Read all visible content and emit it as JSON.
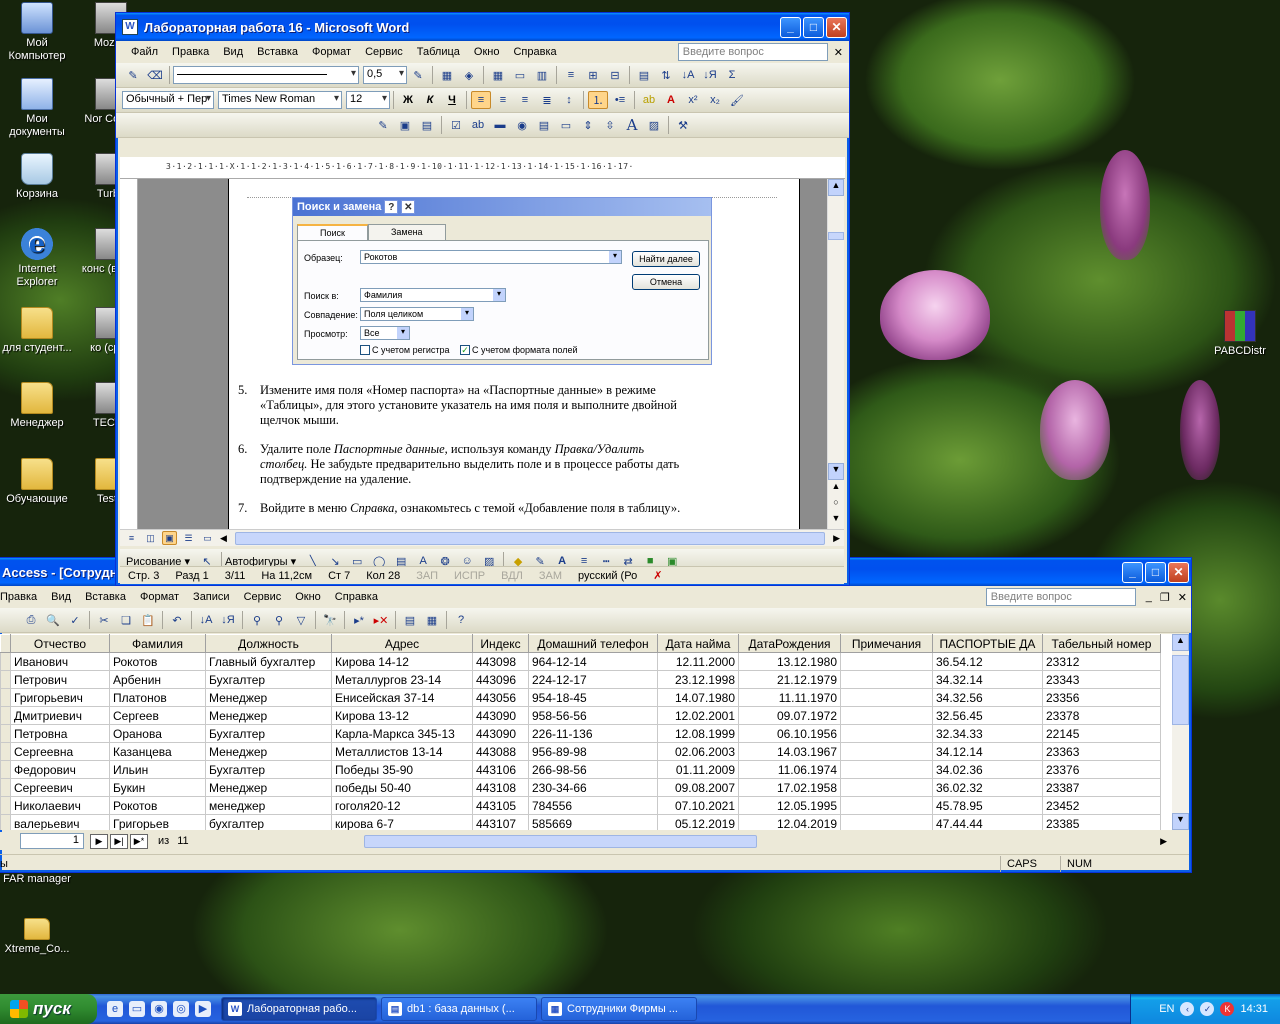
{
  "desktop": {
    "icons_left": [
      {
        "label": "Мой Компьютер",
        "icon": "computer-icon"
      },
      {
        "label": "Мои документы",
        "icon": "my-documents-icon"
      },
      {
        "label": "Корзина",
        "icon": "recycle-bin-icon"
      },
      {
        "label": "Internet Explorer",
        "icon": "internet-explorer-icon"
      },
      {
        "label": "для студент...",
        "icon": "folder-icon"
      },
      {
        "label": "Менеджер",
        "icon": "folder-icon"
      },
      {
        "label": "Обучающие",
        "icon": "folder-icon"
      }
    ],
    "icons_col2": [
      {
        "label": "Mozilla",
        "icon": "firefox-icon"
      },
      {
        "label": "Nor Comm",
        "icon": "app-icon"
      },
      {
        "label": "Turbo",
        "icon": "app-icon"
      },
      {
        "label": "конс (в шко",
        "icon": "app-icon"
      },
      {
        "label": "ко (сред",
        "icon": "app-icon"
      },
      {
        "label": "ТЕСТИ",
        "icon": "app-icon"
      },
      {
        "label": "TestC",
        "icon": "folder-icon"
      }
    ],
    "icons_bottom": [
      {
        "label": "FAR manager",
        "icon": "far-icon"
      },
      {
        "label": "Xtreme_Co...",
        "icon": "folder-icon"
      }
    ],
    "icon_right": {
      "label": "PABCDistr",
      "icon": "winrar-icon"
    }
  },
  "word": {
    "title": "Лабораторная работа 16 - Microsoft Word",
    "menu": [
      "Файл",
      "Правка",
      "Вид",
      "Вставка",
      "Формат",
      "Сервис",
      "Таблица",
      "Окно",
      "Справка"
    ],
    "ask_placeholder": "Введите вопрос",
    "line_width": "0,5",
    "style": "Обычный + Пер",
    "font": "Times New Roman",
    "size": "12",
    "ruler_text": "3·1·2·1·1·1·X·1·1·2·1·3·1·4·1·5·1·6·1·7·1·8·1·9·1·10·1·11·1·12·1·13·1·14·1·15·1·16·1·17·",
    "dialog": {
      "title": "Поиск и замена",
      "tab_find": "Поиск",
      "tab_replace": "Замена",
      "find_label": "Образец:",
      "find_value": "Рокотов",
      "find_next": "Найти далее",
      "cancel": "Отмена",
      "look_in_label": "Поиск в:",
      "look_in_value": "Фамилия",
      "match_label": "Совпадение:",
      "match_value": "Поля целиком",
      "search_label": "Просмотр:",
      "search_value": "Все",
      "match_case": "С учетом регистра",
      "match_format": "С учетом формата полей"
    },
    "items": [
      {
        "num": "5.",
        "line1": "Измените имя поля «Номер паспорта» на «Паспортные данные» в режиме",
        "line2": "«Таблицы», для этого установите указатель на имя поля и выполните двойной",
        "line3": "щелчок мыши."
      },
      {
        "num": "6.",
        "pre": "Удалите поле ",
        "em1": "Паспортные данные,",
        "mid": " используя команду ",
        "em2": "Правка/Удалить",
        "line2_em": "столбец.",
        "line2_rest": " Не забудьте предварительно выделить поле и в процессе работы дать",
        "line3": "подтверждение на удаление."
      },
      {
        "num": "7.",
        "pre": "Войдите в меню ",
        "em1": "Справка,",
        "post": " ознакомьтесь с темой «Добавление поля в таблицу»."
      }
    ],
    "drawing_label": "Рисование ▾",
    "autoshapes_label": "Автофигуры ▾",
    "status": {
      "page": "Стр.  3",
      "section": "Разд  1",
      "pages": "3/11",
      "at": "На 11,2см",
      "line": "Ст  7",
      "col": "Кол  28",
      "rec": "ЗАП",
      "trk": "ИСПР",
      "ext": "ВДЛ",
      "ovr": "ЗАМ",
      "lang": "русский (Ро"
    }
  },
  "access": {
    "title": "Access - [Сотрудн",
    "menu": [
      "Правка",
      "Вид",
      "Вставка",
      "Формат",
      "Записи",
      "Сервис",
      "Окно",
      "Справка"
    ],
    "ask_placeholder": "Введите вопрос",
    "columns": [
      "Отчество",
      "Фамилия",
      "Должность",
      "Адрес",
      "Индекс",
      "Домашний телефон",
      "Дата найма",
      "ДатаРождения",
      "Примечания",
      "ПАСПОРТЫЕ ДА",
      "Табельный номер"
    ],
    "rows": [
      [
        "Иванович",
        "Рокотов",
        "Главный бухгалтер",
        "Кирова 14-12",
        "443098",
        "964-12-14",
        "12.11.2000",
        "13.12.1980",
        "",
        "36.54.12",
        "23312"
      ],
      [
        "Петрович",
        "Арбенин",
        "Бухгалтер",
        "Металлургов 23-14",
        "443096",
        "224-12-17",
        "23.12.1998",
        "21.12.1979",
        "",
        "34.32.14",
        "23343"
      ],
      [
        "Григорьевич",
        "Платонов",
        "Менеджер",
        "Енисейская 37-14",
        "443056",
        "954-18-45",
        "14.07.1980",
        "11.11.1970",
        "",
        "34.32.56",
        "23356"
      ],
      [
        "Дмитриевич",
        "Сергеев",
        "Менеджер",
        "Кирова 13-12",
        "443090",
        "958-56-56",
        "12.02.2001",
        "09.07.1972",
        "",
        "32.56.45",
        "23378"
      ],
      [
        "Петровна",
        "Оранова",
        "Бухгалтер",
        "Карла-Маркса 345-13",
        "443090",
        "226-11-136",
        "12.08.1999",
        "06.10.1956",
        "",
        "32.34.33",
        "22145"
      ],
      [
        "Сергеевна",
        "Казанцева",
        "Менеджер",
        "Металлистов 13-14",
        "443088",
        "956-89-98",
        "02.06.2003",
        "14.03.1967",
        "",
        "34.12.14",
        "23363"
      ],
      [
        "Федорович",
        "Ильин",
        "Бухгалтер",
        "Победы 35-90",
        "443106",
        "266-98-56",
        "01.11.2009",
        "11.06.1974",
        "",
        "34.02.36",
        "23376"
      ],
      [
        "Сергеевич",
        "Букин",
        "Менеджер",
        "победы 50-40",
        "443108",
        "230-34-66",
        "09.08.2007",
        "17.02.1958",
        "",
        "36.02.32",
        "23387"
      ],
      [
        "Николаевич",
        "Рокотов",
        "менеджер",
        "гоголя20-12",
        "443105",
        "784556",
        "07.10.2021",
        "12.05.1995",
        "",
        "45.78.95",
        "23452"
      ],
      [
        "валерьевич",
        "Григорьев",
        "бухгалтер",
        "кирова 6-7",
        "443107",
        "585669",
        "05.12.2019",
        "12.04.2019",
        "",
        "47.44.44",
        "23385"
      ]
    ],
    "nav": {
      "record": "1",
      "of_label": "из",
      "total": "11"
    },
    "status": {
      "left": "ы",
      "caps": "CAPS",
      "num": "NUM"
    }
  },
  "taskbar": {
    "start": "пуск",
    "tasks": [
      "Лабораторная рабо...",
      "db1 : база данных (...",
      "Сотрудники Фирмы ..."
    ],
    "lang": "EN",
    "time": "14:31"
  }
}
